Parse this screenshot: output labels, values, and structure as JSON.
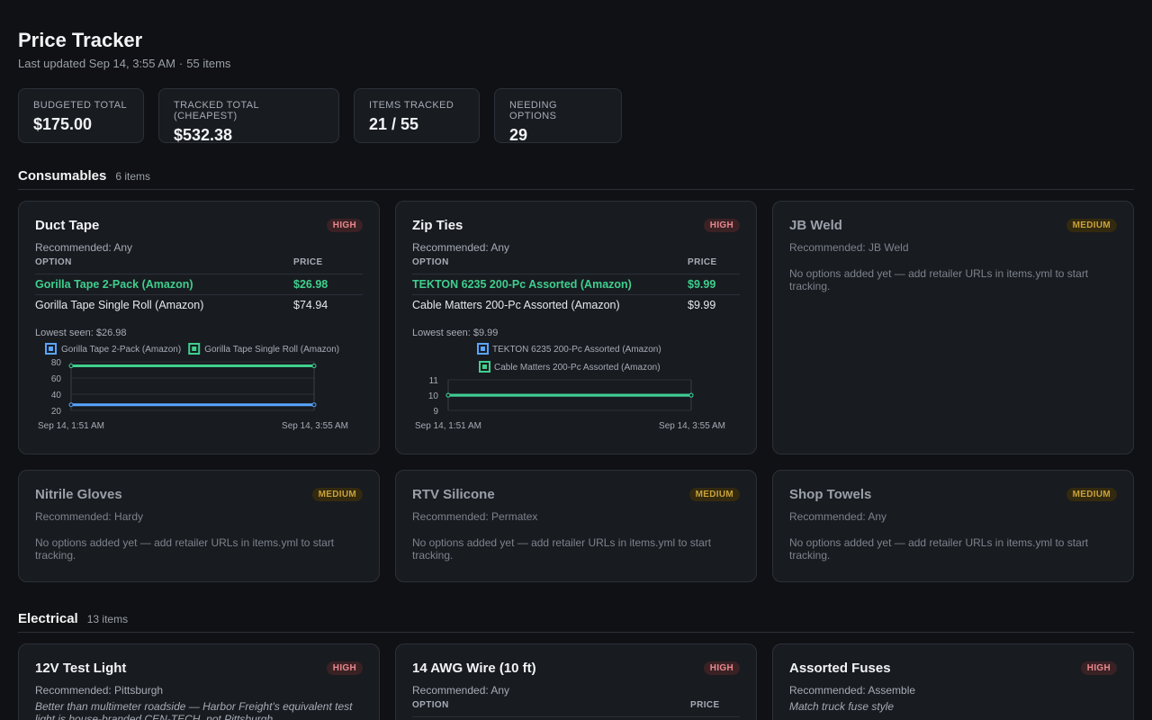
{
  "header": {
    "title": "Price Tracker",
    "updated": "Last updated Sep 14, 3:55 AM",
    "separator": "·",
    "count": "55 items"
  },
  "stats": [
    {
      "label": "BUDGETED TOTAL",
      "value": "$175.00"
    },
    {
      "label": "TRACKED TOTAL (CHEAPEST)",
      "value": "$532.38"
    },
    {
      "label": "ITEMS TRACKED",
      "value": "21 / 55"
    },
    {
      "label": "NEEDING OPTIONS",
      "value": "29"
    }
  ],
  "colors": {
    "series1": "#58a6ff",
    "series2": "#3fcf8e",
    "high": "#e8888e",
    "medium": "#c9a23a"
  },
  "sections": [
    {
      "title": "Consumables",
      "count": "6 items",
      "cards": [
        {
          "title": "Duct Tape",
          "priority": "HIGH",
          "recommended": "Recommended: Any",
          "col_option": "OPTION",
          "col_price": "PRICE",
          "options": [
            {
              "name": "Gorilla Tape 2-Pack (Amazon)",
              "price": "$26.98"
            },
            {
              "name": "Gorilla Tape Single Roll (Amazon)",
              "price": "$74.94"
            }
          ],
          "lowest": "Lowest seen: $26.98"
        },
        {
          "title": "Zip Ties",
          "priority": "HIGH",
          "recommended": "Recommended: Any",
          "col_option": "OPTION",
          "col_price": "PRICE",
          "options": [
            {
              "name": "TEKTON 6235 200-Pc Assorted (Amazon)",
              "price": "$9.99"
            },
            {
              "name": "Cable Matters 200-Pc Assorted (Amazon)",
              "price": "$9.99"
            }
          ],
          "lowest": "Lowest seen: $9.99"
        },
        {
          "title": "JB Weld",
          "priority": "MEDIUM",
          "recommended": "Recommended: JB Weld",
          "empty": "No options added yet — add retailer URLs in items.yml to start tracking."
        },
        {
          "title": "Nitrile Gloves",
          "priority": "MEDIUM",
          "recommended": "Recommended: Hardy",
          "empty": "No options added yet — add retailer URLs in items.yml to start tracking."
        },
        {
          "title": "RTV Silicone",
          "priority": "MEDIUM",
          "recommended": "Recommended: Permatex",
          "empty": "No options added yet — add retailer URLs in items.yml to start tracking."
        },
        {
          "title": "Shop Towels",
          "priority": "MEDIUM",
          "recommended": "Recommended: Any",
          "empty": "No options added yet — add retailer URLs in items.yml to start tracking."
        }
      ]
    },
    {
      "title": "Electrical",
      "count": "13 items",
      "cards": [
        {
          "title": "12V Test Light",
          "priority": "HIGH",
          "recommended": "Recommended: Pittsburgh",
          "note": "Better than multimeter roadside — Harbor Freight's equivalent test light is house-branded CEN-TECH, not Pittsburgh"
        },
        {
          "title": "14 AWG Wire (10 ft)",
          "priority": "HIGH",
          "recommended": "Recommended: Any",
          "col_option": "OPTION",
          "col_price": "PRICE"
        },
        {
          "title": "Assorted Fuses",
          "priority": "HIGH",
          "recommended": "Recommended: Assemble",
          "note": "Match truck fuse style"
        }
      ]
    }
  ],
  "chart_data": [
    {
      "type": "line",
      "title": "",
      "x": [
        "Sep 14, 1:51 AM",
        "Sep 14, 3:55 AM"
      ],
      "series": [
        {
          "name": "Gorilla Tape 2-Pack (Amazon)",
          "values": [
            26.98,
            26.98
          ]
        },
        {
          "name": "Gorilla Tape Single Roll (Amazon)",
          "values": [
            74.94,
            74.94
          ]
        }
      ],
      "yticks": [
        20,
        40,
        60,
        80
      ],
      "ylim": [
        20,
        80
      ],
      "grid": true,
      "legend": "top"
    },
    {
      "type": "line",
      "title": "",
      "x": [
        "Sep 14, 1:51 AM",
        "Sep 14, 3:55 AM"
      ],
      "series": [
        {
          "name": "TEKTON 6235 200-Pc Assorted (Amazon)",
          "values": [
            9.99,
            9.99
          ]
        },
        {
          "name": "Cable Matters 200-Pc Assorted (Amazon)",
          "values": [
            9.99,
            9.99
          ]
        }
      ],
      "yticks": [
        9,
        10,
        11
      ],
      "ylim": [
        9,
        11
      ],
      "grid": true,
      "legend": "top"
    }
  ]
}
